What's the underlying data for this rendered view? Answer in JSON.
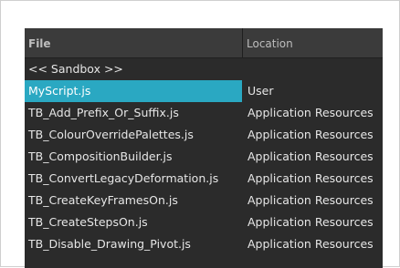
{
  "table": {
    "headers": {
      "file": "File",
      "location": "Location"
    },
    "rows": [
      {
        "file": "<< Sandbox >>",
        "location": "",
        "selected": false
      },
      {
        "file": "MyScript.js",
        "location": "User",
        "selected": true
      },
      {
        "file": "TB_Add_Prefix_Or_Suffix.js",
        "location": "Application Resources",
        "selected": false
      },
      {
        "file": "TB_ColourOverridePalettes.js",
        "location": "Application Resources",
        "selected": false
      },
      {
        "file": "TB_CompositionBuilder.js",
        "location": "Application Resources",
        "selected": false
      },
      {
        "file": "TB_ConvertLegacyDeformation.js",
        "location": "Application Resources",
        "selected": false
      },
      {
        "file": "TB_CreateKeyFramesOn.js",
        "location": "Application Resources",
        "selected": false
      },
      {
        "file": "TB_CreateStepsOn.js",
        "location": "Application Resources",
        "selected": false
      },
      {
        "file": "TB_Disable_Drawing_Pivot.js",
        "location": "Application Resources",
        "selected": false
      }
    ]
  },
  "colors": {
    "panel_background": "#2b2b2b",
    "header_background": "#3b3b3b",
    "selection": "#2aa8c2",
    "text": "#e6e6e6"
  }
}
